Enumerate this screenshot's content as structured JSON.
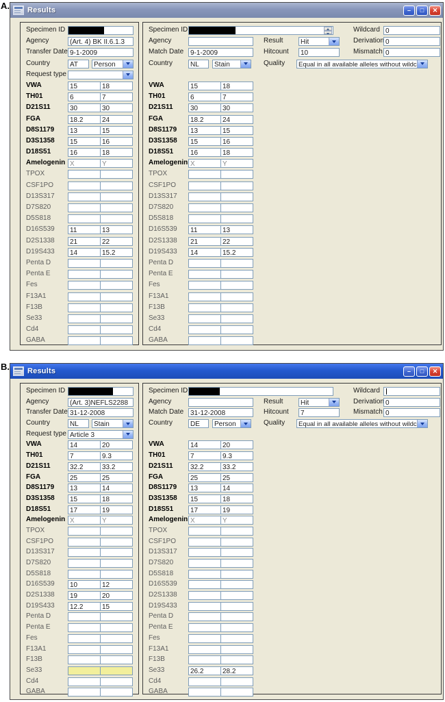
{
  "figure": {
    "label_a": "A.",
    "label_b": "B."
  },
  "bold_loci": [
    "VWA",
    "TH01",
    "D21S11",
    "FGA",
    "D8S1179",
    "D3S1358",
    "D18S51",
    "Amelogenin"
  ],
  "colors": {
    "titlebar_active": "#2459CE",
    "titlebar_inactive": "#8896BA",
    "window_background": "#ECE9D8",
    "field_border": "#7F9DB9",
    "highlight_yellow": "#F2EF9C",
    "redaction_black": "#000000"
  },
  "windows": [
    {
      "figure_label": "A.",
      "title": "Results",
      "left": {
        "specimen_id": {
          "label": "Specimen ID",
          "value": "",
          "redacted": true
        },
        "agency": {
          "label": "Agency",
          "value": "(Art. 4) BK II.6.1.3"
        },
        "date": {
          "label": "Transfer Date",
          "value": "9-1-2009"
        },
        "country": {
          "label": "Country",
          "code": "AT",
          "type": "Person"
        },
        "request_type": {
          "label": "Request type",
          "value": ""
        },
        "loci": [
          {
            "name": "VWA",
            "values": [
              "15",
              "18"
            ]
          },
          {
            "name": "TH01",
            "values": [
              "6",
              "7"
            ]
          },
          {
            "name": "D21S11",
            "values": [
              "30",
              "30"
            ]
          },
          {
            "name": "FGA",
            "values": [
              "18.2",
              "24"
            ]
          },
          {
            "name": "D8S1179",
            "values": [
              "13",
              "15"
            ]
          },
          {
            "name": "D3S1358",
            "values": [
              "15",
              "16"
            ]
          },
          {
            "name": "D18S51",
            "values": [
              "16",
              "18"
            ]
          },
          {
            "name": "Amelogenin",
            "values": [
              "X",
              "Y"
            ],
            "muted": true
          },
          {
            "name": "TPOX",
            "values": [
              "",
              ""
            ]
          },
          {
            "name": "CSF1PO",
            "values": [
              "",
              ""
            ]
          },
          {
            "name": "D13S317",
            "values": [
              "",
              ""
            ]
          },
          {
            "name": "D7S820",
            "values": [
              "",
              ""
            ]
          },
          {
            "name": "D5S818",
            "values": [
              "",
              ""
            ]
          },
          {
            "name": "D16S539",
            "values": [
              "11",
              "13"
            ]
          },
          {
            "name": "D2S1338",
            "values": [
              "21",
              "22"
            ]
          },
          {
            "name": "D19S433",
            "values": [
              "14",
              "15.2"
            ]
          },
          {
            "name": "Penta D",
            "values": [
              "",
              ""
            ]
          },
          {
            "name": "Penta E",
            "values": [
              "",
              ""
            ]
          },
          {
            "name": "Fes",
            "values": [
              "",
              ""
            ]
          },
          {
            "name": "F13A1",
            "values": [
              "",
              ""
            ]
          },
          {
            "name": "F13B",
            "values": [
              "",
              ""
            ]
          },
          {
            "name": "Se33",
            "values": [
              "",
              ""
            ]
          },
          {
            "name": "Cd4",
            "values": [
              "",
              ""
            ]
          },
          {
            "name": "GABA",
            "values": [
              "",
              ""
            ]
          }
        ]
      },
      "right": {
        "specimen_id": {
          "label": "Specimen ID",
          "value": "",
          "redacted": true,
          "has_spinner": true
        },
        "agency": {
          "label": "Agency",
          "value": ""
        },
        "date": {
          "label": "Match Date",
          "value": "9-1-2009"
        },
        "country": {
          "label": "Country",
          "code": "NL",
          "type": "Stain"
        },
        "result": {
          "label": "Result",
          "value": "Hit"
        },
        "hitcount": {
          "label": "Hitcount",
          "value": "10"
        },
        "quality": {
          "label": "Quality",
          "value": "Equal in all available alleles without wildcards"
        },
        "wildcard": {
          "label": "Wildcard",
          "value": "0"
        },
        "derivation": {
          "label": "Derivation",
          "value": "0"
        },
        "mismatch": {
          "label": "Mismatch",
          "value": "0"
        },
        "loci": [
          {
            "name": "VWA",
            "values": [
              "15",
              "18"
            ]
          },
          {
            "name": "TH01",
            "values": [
              "6",
              "7"
            ]
          },
          {
            "name": "D21S11",
            "values": [
              "30",
              "30"
            ]
          },
          {
            "name": "FGA",
            "values": [
              "18.2",
              "24"
            ]
          },
          {
            "name": "D8S1179",
            "values": [
              "13",
              "15"
            ]
          },
          {
            "name": "D3S1358",
            "values": [
              "15",
              "16"
            ]
          },
          {
            "name": "D18S51",
            "values": [
              "16",
              "18"
            ]
          },
          {
            "name": "Amelogenin",
            "values": [
              "X",
              "Y"
            ],
            "muted": true
          },
          {
            "name": "TPOX",
            "values": [
              "",
              ""
            ]
          },
          {
            "name": "CSF1PO",
            "values": [
              "",
              ""
            ]
          },
          {
            "name": "D13S317",
            "values": [
              "",
              ""
            ]
          },
          {
            "name": "D7S820",
            "values": [
              "",
              ""
            ]
          },
          {
            "name": "D5S818",
            "values": [
              "",
              ""
            ]
          },
          {
            "name": "D16S539",
            "values": [
              "11",
              "13"
            ]
          },
          {
            "name": "D2S1338",
            "values": [
              "21",
              "22"
            ]
          },
          {
            "name": "D19S433",
            "values": [
              "14",
              "15.2"
            ]
          },
          {
            "name": "Penta D",
            "values": [
              "",
              ""
            ]
          },
          {
            "name": "Penta E",
            "values": [
              "",
              ""
            ]
          },
          {
            "name": "Fes",
            "values": [
              "",
              ""
            ]
          },
          {
            "name": "F13A1",
            "values": [
              "",
              ""
            ]
          },
          {
            "name": "F13B",
            "values": [
              "",
              ""
            ]
          },
          {
            "name": "Se33",
            "values": [
              "",
              ""
            ]
          },
          {
            "name": "Cd4",
            "values": [
              "",
              ""
            ]
          },
          {
            "name": "GABA",
            "values": [
              "",
              ""
            ]
          }
        ]
      }
    },
    {
      "figure_label": "B.",
      "title": "Results",
      "left": {
        "specimen_id": {
          "label": "Specimen ID",
          "value": "",
          "redacted": true
        },
        "agency": {
          "label": "Agency",
          "value": "(Art. 3)NEFLS2288"
        },
        "date": {
          "label": "Transfer Date",
          "value": "31-12-2008"
        },
        "country": {
          "label": "Country",
          "code": "NL",
          "type": "Stain"
        },
        "request_type": {
          "label": "Request type",
          "value": "Article 3"
        },
        "loci": [
          {
            "name": "VWA",
            "values": [
              "14",
              "20"
            ]
          },
          {
            "name": "TH01",
            "values": [
              "7",
              "9.3"
            ]
          },
          {
            "name": "D21S11",
            "values": [
              "32.2",
              "33.2"
            ]
          },
          {
            "name": "FGA",
            "values": [
              "25",
              "25"
            ]
          },
          {
            "name": "D8S1179",
            "values": [
              "13",
              "14"
            ]
          },
          {
            "name": "D3S1358",
            "values": [
              "15",
              "18"
            ]
          },
          {
            "name": "D18S51",
            "values": [
              "17",
              "19"
            ]
          },
          {
            "name": "Amelogenin",
            "values": [
              "X",
              "Y"
            ],
            "muted": true
          },
          {
            "name": "TPOX",
            "values": [
              "",
              ""
            ]
          },
          {
            "name": "CSF1PO",
            "values": [
              "",
              ""
            ]
          },
          {
            "name": "D13S317",
            "values": [
              "",
              ""
            ]
          },
          {
            "name": "D7S820",
            "values": [
              "",
              ""
            ]
          },
          {
            "name": "D5S818",
            "values": [
              "",
              ""
            ]
          },
          {
            "name": "D16S539",
            "values": [
              "10",
              "12"
            ]
          },
          {
            "name": "D2S1338",
            "values": [
              "19",
              "20"
            ]
          },
          {
            "name": "D19S433",
            "values": [
              "12.2",
              "15"
            ]
          },
          {
            "name": "Penta D",
            "values": [
              "",
              ""
            ]
          },
          {
            "name": "Penta E",
            "values": [
              "",
              ""
            ]
          },
          {
            "name": "Fes",
            "values": [
              "",
              ""
            ]
          },
          {
            "name": "F13A1",
            "values": [
              "",
              ""
            ]
          },
          {
            "name": "F13B",
            "values": [
              "",
              ""
            ]
          },
          {
            "name": "Se33",
            "values": [
              "",
              ""
            ],
            "highlight": true
          },
          {
            "name": "Cd4",
            "values": [
              "",
              ""
            ]
          },
          {
            "name": "GABA",
            "values": [
              "",
              ""
            ]
          }
        ]
      },
      "right": {
        "specimen_id": {
          "label": "Specimen ID",
          "value": "",
          "redacted": true,
          "has_spinner": false
        },
        "agency": {
          "label": "Agency",
          "value": ""
        },
        "date": {
          "label": "Match Date",
          "value": "31-12-2008"
        },
        "country": {
          "label": "Country",
          "code": "DE",
          "type": "Person"
        },
        "result": {
          "label": "Result",
          "value": "Hit"
        },
        "hitcount": {
          "label": "Hitcount",
          "value": "7"
        },
        "quality": {
          "label": "Quality",
          "value": "Equal in all available alleles without wildcards"
        },
        "wildcard": {
          "label": "Wildcard",
          "value": "",
          "text_cursor": true
        },
        "derivation": {
          "label": "Derivation",
          "value": "0"
        },
        "mismatch": {
          "label": "Mismatch",
          "value": "0"
        },
        "loci": [
          {
            "name": "VWA",
            "values": [
              "14",
              "20"
            ]
          },
          {
            "name": "TH01",
            "values": [
              "7",
              "9.3"
            ]
          },
          {
            "name": "D21S11",
            "values": [
              "32.2",
              "33.2"
            ]
          },
          {
            "name": "FGA",
            "values": [
              "25",
              "25"
            ]
          },
          {
            "name": "D8S1179",
            "values": [
              "13",
              "14"
            ]
          },
          {
            "name": "D3S1358",
            "values": [
              "15",
              "18"
            ]
          },
          {
            "name": "D18S51",
            "values": [
              "17",
              "19"
            ]
          },
          {
            "name": "Amelogenin",
            "values": [
              "X",
              "Y"
            ],
            "muted": true
          },
          {
            "name": "TPOX",
            "values": [
              "",
              ""
            ]
          },
          {
            "name": "CSF1PO",
            "values": [
              "",
              ""
            ]
          },
          {
            "name": "D13S317",
            "values": [
              "",
              ""
            ]
          },
          {
            "name": "D7S820",
            "values": [
              "",
              ""
            ]
          },
          {
            "name": "D5S818",
            "values": [
              "",
              ""
            ]
          },
          {
            "name": "D16S539",
            "values": [
              "",
              ""
            ]
          },
          {
            "name": "D2S1338",
            "values": [
              "",
              ""
            ]
          },
          {
            "name": "D19S433",
            "values": [
              "",
              ""
            ]
          },
          {
            "name": "Penta D",
            "values": [
              "",
              ""
            ]
          },
          {
            "name": "Penta E",
            "values": [
              "",
              ""
            ]
          },
          {
            "name": "Fes",
            "values": [
              "",
              ""
            ]
          },
          {
            "name": "F13A1",
            "values": [
              "",
              ""
            ]
          },
          {
            "name": "F13B",
            "values": [
              "",
              ""
            ]
          },
          {
            "name": "Se33",
            "values": [
              "26.2",
              "28.2"
            ]
          },
          {
            "name": "Cd4",
            "values": [
              "",
              ""
            ]
          },
          {
            "name": "GABA",
            "values": [
              "",
              ""
            ]
          }
        ]
      }
    }
  ]
}
